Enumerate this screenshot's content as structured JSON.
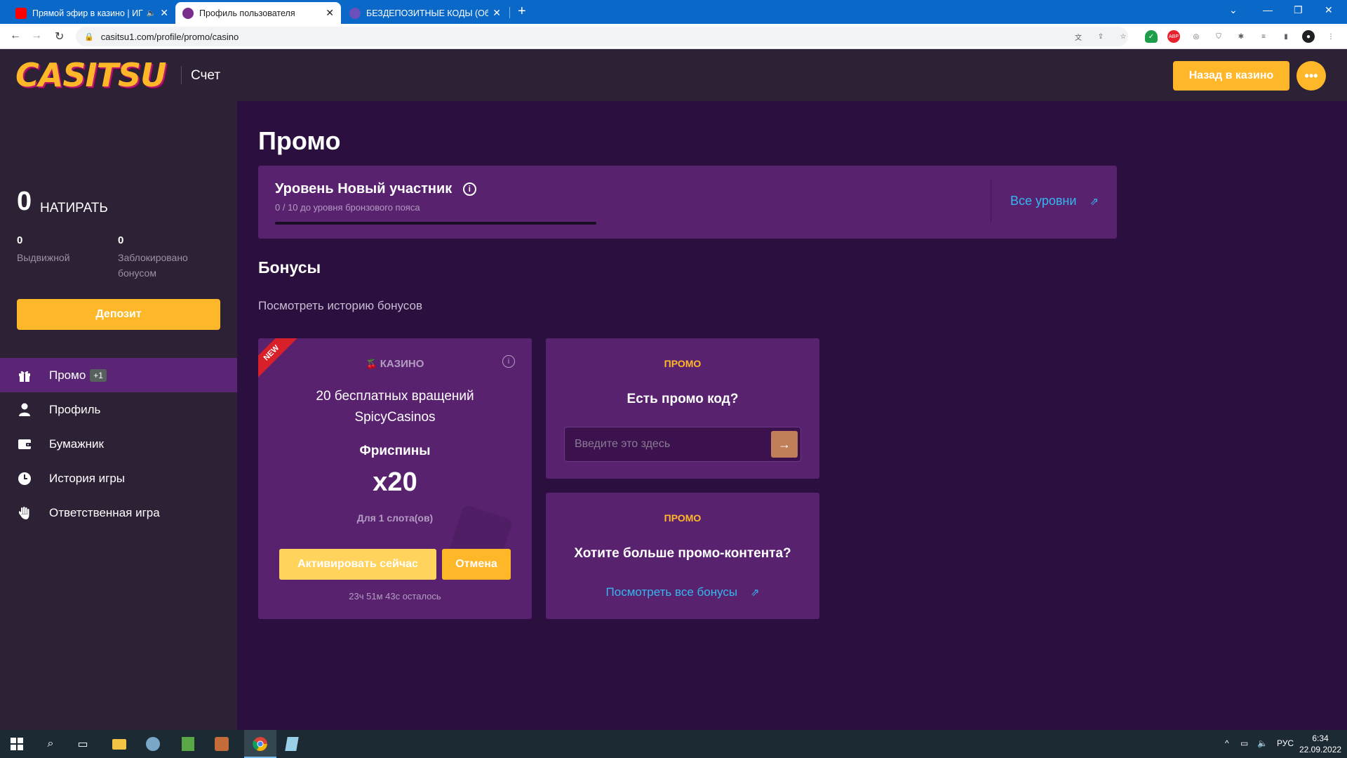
{
  "browser": {
    "tabs": [
      {
        "title": "Прямой эфир в казино | ИГ",
        "favicon_color": "#ff0000"
      },
      {
        "title": "Профиль пользователя",
        "favicon_color": "#7b2d8e"
      },
      {
        "title": "БЕЗДЕПОЗИТНЫЕ КОДЫ (Обно",
        "favicon_color": "#6b4fbb"
      }
    ],
    "url": "casitsu1.com/profile/promo/casino"
  },
  "header": {
    "logo_text": "CASITSU",
    "section_title": "Счет",
    "back_button": "Назад в казино",
    "more_icon": "more-dots-icon"
  },
  "sidebar": {
    "balance": {
      "amount": "0",
      "currency": "НАТИРАТЬ"
    },
    "withdrawable": {
      "value": "0",
      "label": "Выдвижной"
    },
    "locked": {
      "value": "0",
      "label": "Заблокировано бонусом"
    },
    "deposit_button": "Депозит",
    "nav": [
      {
        "label": "Промо",
        "badge": "+1",
        "icon": "gift-icon",
        "active": true
      },
      {
        "label": "Профиль",
        "icon": "user-icon",
        "active": false
      },
      {
        "label": "Бумажник",
        "icon": "wallet-icon",
        "active": false
      },
      {
        "label": "История игры",
        "icon": "clock-icon",
        "active": false
      },
      {
        "label": "Ответственная игра",
        "icon": "hand-icon",
        "active": false
      }
    ]
  },
  "main": {
    "page_title": "Промо",
    "level": {
      "title": "Уровень Новый участник",
      "progress_text": "0 / 10 до уровня бронзового пояса",
      "progress_fraction": 0.0,
      "all_levels_link": "Все уровни"
    },
    "bonuses": {
      "heading": "Бонусы",
      "history_link": "Посмотреть историю бонусов"
    },
    "bonus_card": {
      "ribbon": "NEW",
      "category": "КАЗИНО",
      "title_line1": "20 бесплатных вращений",
      "title_line2": "SpicyCasinos",
      "type": "Фриспины",
      "multiplier": "x20",
      "slots": "Для 1 слота(ов)",
      "activate_button": "Активировать сейчас",
      "cancel_button": "Отмена",
      "time_left": "23ч 51м 43с осталось"
    },
    "promo_code_card": {
      "tag": "ПРОМО",
      "question": "Есть промо код?",
      "input_placeholder": "Введите это здесь",
      "input_value": ""
    },
    "more_promo_card": {
      "tag": "ПРОМО",
      "question": "Хотите больше промо-контента?",
      "link": "Посмотреть все бонусы"
    }
  },
  "taskbar": {
    "tray_lang": "РУС",
    "time": "6:34",
    "date": "22.09.2022"
  },
  "colors": {
    "accent": "#ffb72a",
    "link": "#35b6f0",
    "panel": "#59226f",
    "sidebar": "#2d2235",
    "background": "#2a0f3f"
  }
}
